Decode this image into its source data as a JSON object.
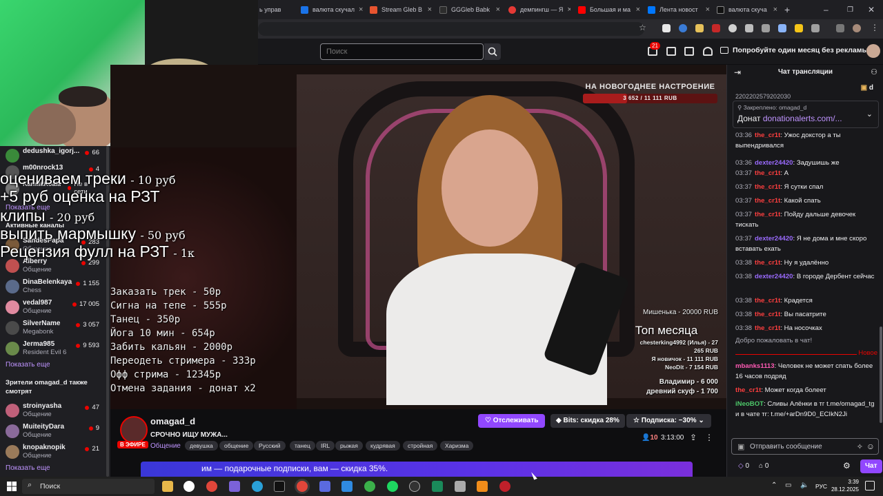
{
  "browser": {
    "tabs": [
      {
        "label": "ь управ",
        "icon_color": "#3b3b3b"
      },
      {
        "label": "валюта скучал",
        "icon_color": "#1a73e8"
      },
      {
        "label": "Stream Gleb B",
        "icon_color": "#e8542f"
      },
      {
        "label": "GGGleb Babk",
        "icon_color": "#2d2d2d"
      },
      {
        "label": "демпингш — Я",
        "icon_color": "#e53935"
      },
      {
        "label": "Большая и ма",
        "icon_color": "#ff0000"
      },
      {
        "label": "Лента новост",
        "icon_color": "#0077ff"
      },
      {
        "label": "валюта скуча",
        "icon_color": "#111111"
      }
    ],
    "new_tab": "+"
  },
  "topnav": {
    "search_placeholder": "Поиск",
    "notifications_count": "21",
    "promo": "Попробуйте один месяц без рекламы"
  },
  "sidebar": {
    "followed": [
      {
        "name": "dedushka_igorj...",
        "category": "",
        "viewers": "66",
        "avatar": "#3a8a3a"
      },
      {
        "name": "m00nrock13",
        "category": "",
        "viewers": "4",
        "avatar": "#555"
      },
      {
        "name": "KarmikKoala",
        "category": "Не в сети",
        "viewers": "",
        "avatar": "#777"
      }
    ],
    "show_more_1": "Показать еще",
    "active_heading": "Активные каналы",
    "active": [
      {
        "name": "SandesPapa",
        "category": "Общение",
        "viewers": "283",
        "avatar": "#7a5a3a"
      },
      {
        "name": "Alberry",
        "category": "Общение",
        "viewers": "299",
        "avatar": "#c05050"
      },
      {
        "name": "DinaBelenkaya",
        "category": "Chess",
        "viewers": "1 155",
        "avatar": "#5a6a8a"
      },
      {
        "name": "vedal987",
        "category": "Общение",
        "viewers": "17 005",
        "avatar": "#e08aa0"
      },
      {
        "name": "SilverName",
        "category": "Megabonk",
        "viewers": "3 057",
        "avatar": "#4a4a4a"
      },
      {
        "name": "Jerma985",
        "category": "Resident Evil 6",
        "viewers": "9 593",
        "avatar": "#6a8a4a"
      }
    ],
    "show_more_2": "Показать еще",
    "viewers_heading": "Зрители omagad_d также смотрят",
    "also": [
      {
        "name": "stroinyasha",
        "category": "Общение",
        "viewers": "47",
        "avatar": "#c0607a"
      },
      {
        "name": "MuiteityDara",
        "category": "Общение",
        "viewers": "9",
        "avatar": "#8a6a9a"
      },
      {
        "name": "knopaknopik",
        "category": "Общение",
        "viewers": "21",
        "avatar": "#9a7a5a"
      }
    ],
    "show_more_3": "Показать еще"
  },
  "overlay": [
    {
      "text": "оцениваем треки",
      "price": "- 10 руб"
    },
    {
      "text": "+5 руб оценка на РЗТ",
      "price": ""
    },
    {
      "text": "клипы",
      "price": "- 20 руб"
    },
    {
      "text": "выпить мармышку",
      "price": "- 50 руб"
    },
    {
      "text": "Рецензия фулл на РЗТ",
      "price": "- 1к"
    }
  ],
  "video": {
    "goal_title": "НА НОВОГОДНЕЕ НАСТРОЕНИЕ",
    "goal_progress": "3 652 / 11 111 RUB",
    "goal_fraction": 0.33,
    "menu": [
      "Заказать трек - 50р",
      "Сигна на тепе - 555р",
      "Танец - 350р",
      "Йога 10 мин - 654р",
      "Забить кальян - 2000р",
      "Переодеть стримера - 333р",
      "Офф стрима - 12345р",
      "Отмена задания - донат х2"
    ],
    "last_donation": "Мишенька - 20000 RUB",
    "top_title": "Топ месяца",
    "top_list": [
      "chesterking4992 (Илья) - 27",
      "265 RUB",
      "Я новичок - 11 111 RUB",
      "NeoDit - 7 154 RUB"
    ],
    "bottom_list": [
      "Владимир - 6 000",
      "древний скуф - 1 700"
    ]
  },
  "stream": {
    "name": "omagad_d",
    "live": "В ЭФИРЕ",
    "title": "СРОЧНО ИЩУ МУЖА...",
    "category": "Общение",
    "tags": [
      "девушка",
      "общение",
      "Русский",
      "танец",
      "IRL",
      "рыжая",
      "кудрявая",
      "стройная",
      "Харизма"
    ],
    "follow": "Отслеживать",
    "bits": "Bits: скидка 28%",
    "subscribe": "Подписка: −30%",
    "viewers": "10",
    "uptime": "3:13:00",
    "banner": "им — подарочные подписки, вам — скидка 35%."
  },
  "chat": {
    "title": "Чат трансляции",
    "top_text": "d",
    "scroll_num": "2202202579202030",
    "pinned_by": "Закреплено: omagad_d",
    "pinned_text": "Донат ",
    "pinned_link": "donationalerts.com/...",
    "messages": [
      {
        "time": "03:36",
        "user": "the_cr1t",
        "cls": "u1",
        "text": ": Ужос докстор а ты выпендривался"
      },
      {
        "time": "03:36",
        "user": "dexter24420",
        "cls": "u2",
        "text": ": Задушишь же"
      },
      {
        "time": "03:37",
        "user": "the_cr1t",
        "cls": "u1",
        "text": ": А"
      },
      {
        "time": "03:37",
        "user": "the_cr1t",
        "cls": "u1",
        "text": ": Я сутки спал"
      },
      {
        "time": "03:37",
        "user": "the_cr1t",
        "cls": "u1",
        "text": ": Какой спать"
      },
      {
        "time": "03:37",
        "user": "the_cr1t",
        "cls": "u1",
        "text": ": Пойду дальше девочек тискать"
      },
      {
        "time": "03:37",
        "user": "dexter24420",
        "cls": "u2",
        "text": ": Я не дома и мне скоро вставать ехать"
      },
      {
        "time": "03:38",
        "user": "the_cr1t",
        "cls": "u1",
        "text": ": Ну я удалённо"
      },
      {
        "time": "03:38",
        "user": "dexter24420",
        "cls": "u2",
        "text": ": В городе Дербент сейчас"
      },
      {
        "time": "03:38",
        "user": "the_cr1t",
        "cls": "u1",
        "text": ": Крадется"
      },
      {
        "time": "03:38",
        "user": "the_cr1t",
        "cls": "u1",
        "text": ": Вы пасатрите"
      },
      {
        "time": "03:38",
        "user": "the_cr1t",
        "cls": "u1",
        "text": ": На носочках"
      }
    ],
    "welcome": "Добро пожаловать в чат!",
    "new_label": "Новое",
    "new_messages": [
      {
        "time": "",
        "user": "mbanks1113",
        "cls": "u3",
        "text": ": Человек не может спать более 16 часов подряд"
      },
      {
        "time": "",
        "user": "the_cr1t",
        "cls": "u1",
        "text": ": Может когда болеет"
      },
      {
        "time": "",
        "user": "iNeoBOT",
        "cls": "u4",
        "text": ": Сливы Алёнки в тг t.me/omagad_tg и в чате тг: t.me/+arDn9D0_ECIkN2Ji"
      }
    ],
    "input_placeholder": "Отправить сообщение",
    "points": "0",
    "drops": "0",
    "send": "Чат"
  },
  "taskbar": {
    "search": "Поиск",
    "lang": "РУС",
    "time": "3:39",
    "date": "28.12.2025"
  }
}
